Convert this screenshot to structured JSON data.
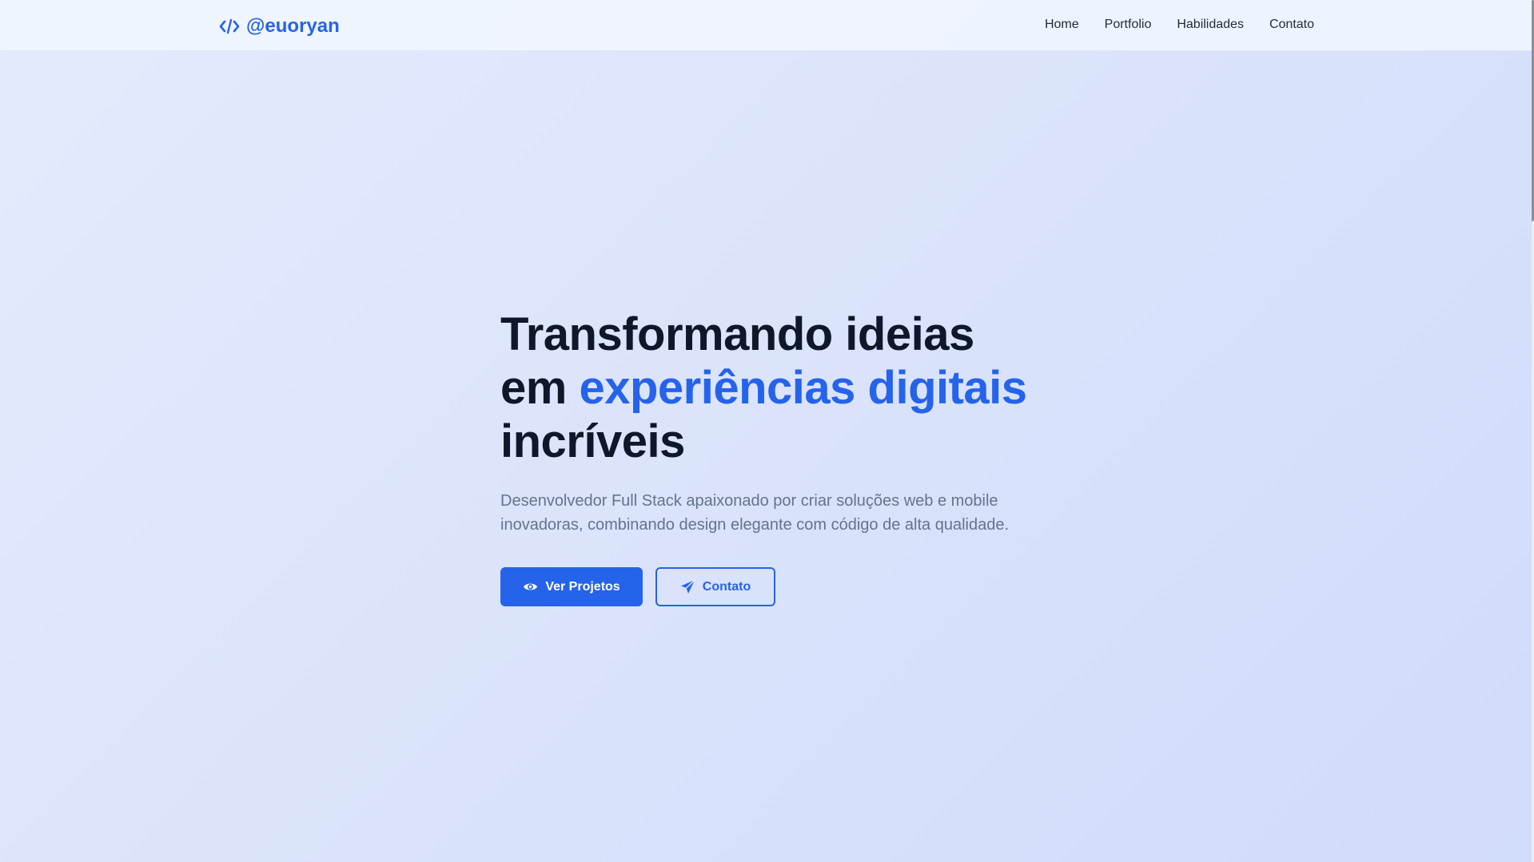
{
  "brand": {
    "icon": "code-icon",
    "name": "@euoryan",
    "color": "#2563eb"
  },
  "nav": {
    "items": [
      {
        "label": "Home"
      },
      {
        "label": "Portfolio"
      },
      {
        "label": "Habilidades"
      },
      {
        "label": "Contato"
      }
    ]
  },
  "hero": {
    "title_line1": "Transformando ideias",
    "title_line2_prefix": "em ",
    "title_line2_accent": "experiências digitais",
    "title_line3": "incríveis",
    "description": "Desenvolvedor Full Stack apaixonado por criar soluções web e mobile inovadoras, combinando design elegante com código de alta qualidade.",
    "primary_button": {
      "label": "Ver Projetos",
      "icon": "eye-icon"
    },
    "secondary_button": {
      "label": "Contato",
      "icon": "paper-plane-icon"
    }
  },
  "colors": {
    "accent": "#2563eb",
    "heading": "#0f172a",
    "muted_text": "#64748b"
  }
}
